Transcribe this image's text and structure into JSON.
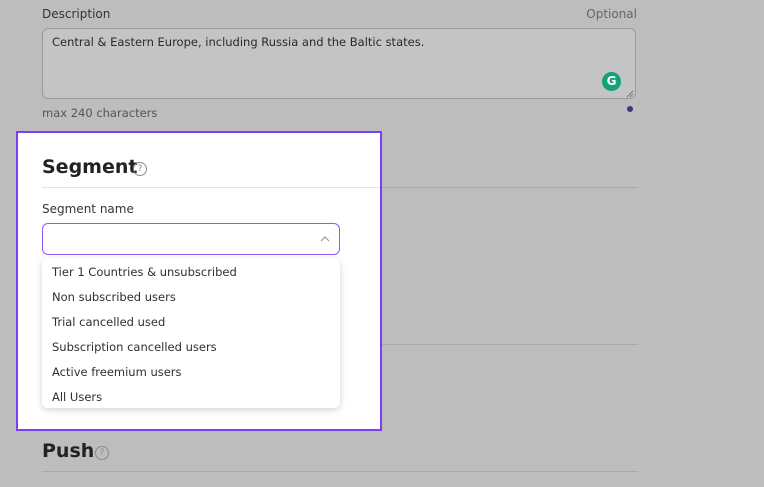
{
  "description": {
    "label": "Description",
    "optional": "Optional",
    "value": "Central & Eastern Europe, including Russia and the Baltic states.",
    "hint": "max 240 characters"
  },
  "segment": {
    "title": "Segment",
    "field_label": "Segment name",
    "selected_value": "",
    "options": [
      "Tier 1 Countries & unsubscribed",
      "Non subscribed users",
      "Trial cancelled used",
      "Subscription cancelled users",
      "Active freemium users",
      "All Users"
    ]
  },
  "push": {
    "title": "Push"
  },
  "icons": {
    "help": "?",
    "grammarly": "G"
  },
  "colors": {
    "highlight": "#7a3ff2",
    "focus": "#8b5cf6",
    "grammarly": "#15a079"
  }
}
